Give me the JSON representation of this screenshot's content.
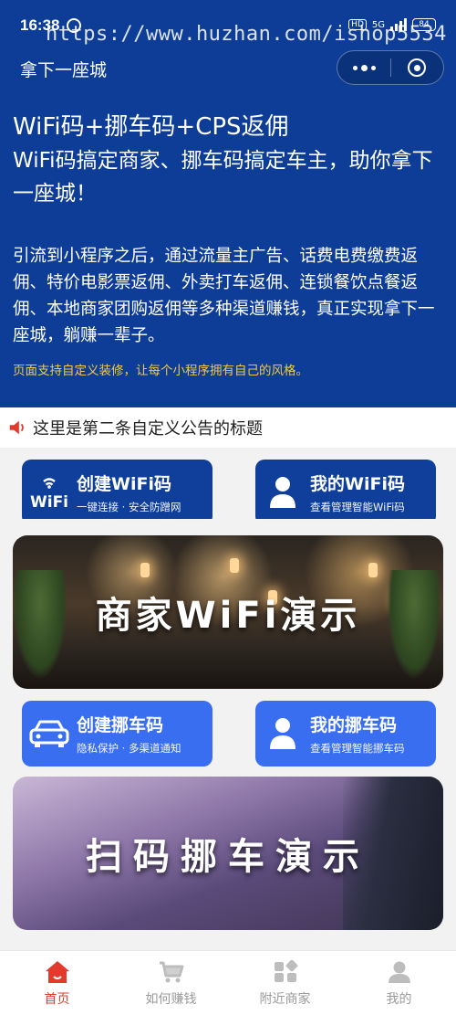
{
  "status_bar": {
    "time": "16:38",
    "network": "5G",
    "hd": "HD",
    "battery": "84"
  },
  "watermark": "https://www.huzhan.com/ishop5534",
  "nav": {
    "title": "拿下一座城"
  },
  "hero": {
    "headline": "WiFi码+挪车码+CPS返佣",
    "sub": "WiFi码搞定商家、挪车码搞定车主，助你拿下一座城！",
    "body": "引流到小程序之后，通过流量主广告、话费电费缴费返佣、特价电影票返佣、外卖打车返佣、连锁餐饮点餐返佣、本地商家团购返佣等多种渠道赚钱，真正实现拿下一座城，躺赚一辈子。",
    "note": "页面支持自定义装修，让每个小程序拥有自己的风格。"
  },
  "notice": {
    "text": "这里是第二条自定义公告的标题"
  },
  "actions": {
    "create_wifi": {
      "title": "创建WiFi码",
      "subtitle": "一键连接 · 安全防蹭网",
      "icon_text": "WiFi"
    },
    "my_wifi": {
      "title": "我的WiFi码",
      "subtitle": "查看管理智能WiFi码"
    },
    "create_move": {
      "title": "创建挪车码",
      "subtitle": "隐私保护 · 多渠道通知"
    },
    "my_move": {
      "title": "我的挪车码",
      "subtitle": "查看管理智能挪车码"
    }
  },
  "banners": {
    "wifi": "商家WiFi演示",
    "car": "扫码挪车演示"
  },
  "tabbar": [
    {
      "label": "首页",
      "icon": "home-icon",
      "active": true
    },
    {
      "label": "如何赚钱",
      "icon": "cart-icon",
      "active": false
    },
    {
      "label": "附近商家",
      "icon": "grid-icon",
      "active": false
    },
    {
      "label": "我的",
      "icon": "user-icon",
      "active": false
    }
  ],
  "colors": {
    "hero_bg": "#0d3d96",
    "accent_red": "#e23b2e",
    "note_yellow": "#f0c84a",
    "button_dark": "#0f3f9b",
    "button_light": "#3a6ef0"
  }
}
